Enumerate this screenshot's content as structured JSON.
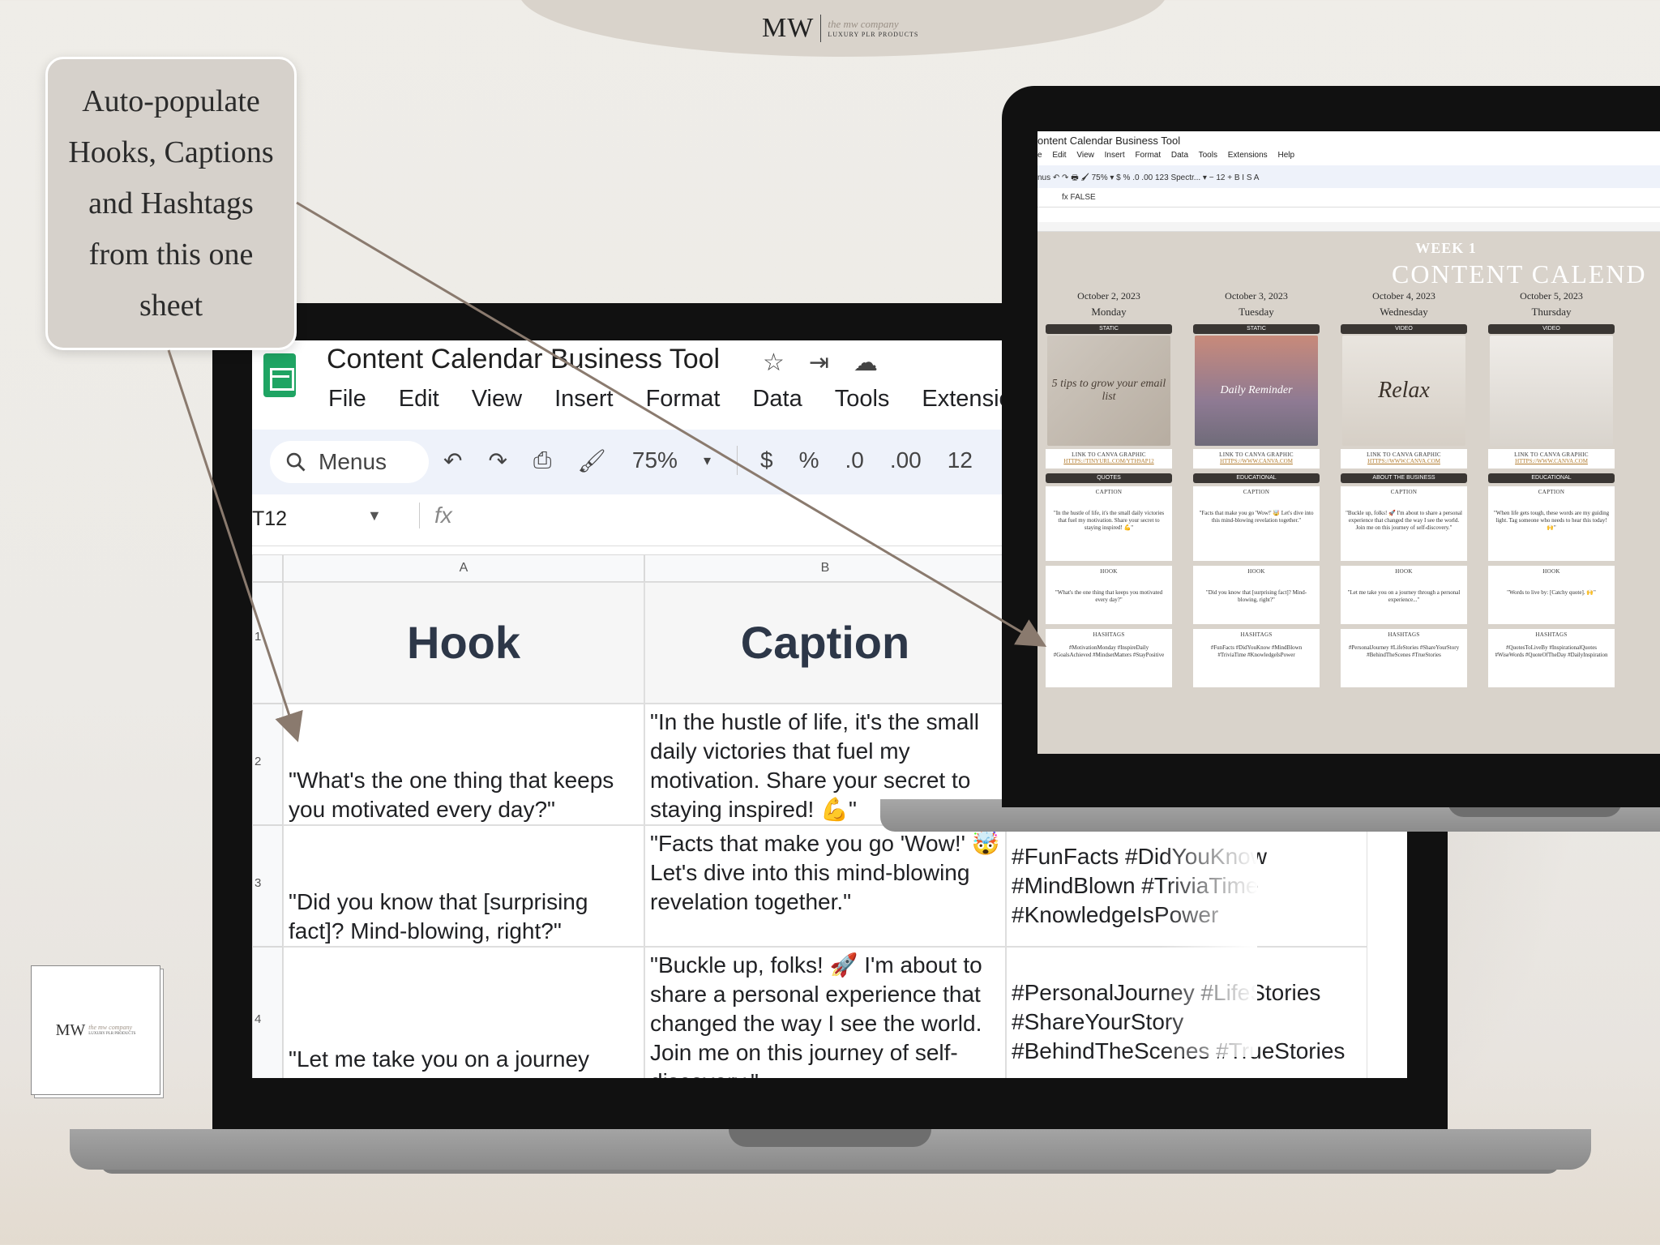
{
  "brand": {
    "initials": "MW",
    "tagline": "the mw company",
    "line": "LUXURY PLR PRODUCTS"
  },
  "callout": {
    "text": "Auto-populate Hooks, Captions and Hashtags from this one sheet"
  },
  "sheet": {
    "title": "Content Calendar Business Tool",
    "menu": [
      "File",
      "Edit",
      "View",
      "Insert",
      "Format",
      "Data",
      "Tools",
      "Extensions"
    ],
    "search_label": "Menus",
    "zoom": "75%",
    "currency": "$",
    "percent": "%",
    "dec_less": ".0",
    "dec_more": ".00",
    "fmt_more": "12",
    "cell_ref": "T12",
    "columns": [
      "A",
      "B"
    ],
    "row_numbers": [
      "1",
      "2",
      "3",
      "4"
    ],
    "headers": {
      "hook": "Hook",
      "caption": "Caption"
    },
    "rows": [
      {
        "hook": "\"What's the one thing that keeps you motivated every day?\"",
        "caption": "\"In the hustle of life, it's the small daily victories that fuel my motivation. Share your secret to staying inspired! 💪\"",
        "hashtags": ""
      },
      {
        "hook": "\"Did you know that [surprising fact]? Mind-blowing, right?\"",
        "caption": "\"Facts that make you go 'Wow!' 🤯 Let's dive into this mind-blowing revelation together.\"",
        "hashtags": "#FunFacts #DidYouKnow #MindBlown #TriviaTime #KnowledgeIsPower"
      },
      {
        "hook": "\"Let me take you on a journey through a personal experience...\"",
        "caption": "\"Buckle up, folks! 🚀 I'm about to share a personal experience that changed the way I see the world. Join me on this journey of self-discovery.\"",
        "hashtags": "#PersonalJourney #LifeStories #ShareYourStory #BehindTheScenes #TrueStories"
      }
    ]
  },
  "calendar": {
    "title": "ontent Calendar Business Tool",
    "menu": [
      "e",
      "Edit",
      "View",
      "Insert",
      "Format",
      "Data",
      "Tools",
      "Extensions",
      "Help"
    ],
    "toolbar": "nus   ↶  ↷  🖶  🖌  75%  ▾   $   %   .0   .00   123   Spectr... ▾   −  12  +   B   I   S   A",
    "formula": "fx  FALSE",
    "week": "WEEK 1",
    "heading": "CONTENT CALEND",
    "link_label": "LINK TO CANVA GRAPHIC",
    "caption_label": "CAPTION",
    "hook_label": "HOOK",
    "hashtags_label": "HASHTAGS",
    "days": [
      {
        "date": "October 2, 2023",
        "name": "Monday",
        "type": "STATIC",
        "graphic": "5 tips to grow your email list",
        "link": "HTTPS://TINYURL.COM/YTH9AP12",
        "category": "QUOTES",
        "caption": "\"In the hustle of life, it's the small daily victories that fuel my motivation. Share your secret to staying inspired! 💪\"",
        "hook": "\"What's the one thing that keeps you motivated every day?\"",
        "hashtags": "#MotivationMonday #InspireDaily #GoalsAchieved #MindsetMatters #StayPositive"
      },
      {
        "date": "October 3, 2023",
        "name": "Tuesday",
        "type": "STATIC",
        "graphic": "Daily Reminder",
        "link": "HTTPS://WWW.CANVA.COM",
        "category": "EDUCATIONAL",
        "caption": "\"Facts that make you go 'Wow!' 🤯 Let's dive into this mind-blowing revelation together.\"",
        "hook": "\"Did you know that [surprising fact]? Mind-blowing, right?\"",
        "hashtags": "#FunFacts #DidYouKnow #MindBlown #TriviaTime #KnowledgeIsPower"
      },
      {
        "date": "October 4, 2023",
        "name": "Wednesday",
        "type": "VIDEO",
        "graphic": "Relax",
        "link": "HTTPS://WWW.CANVA.COM",
        "category": "ABOUT THE BUSINESS",
        "caption": "\"Buckle up, folks! 🚀 I'm about to share a personal experience that changed the way I see the world. Join me on this journey of self-discovery.\"",
        "hook": "\"Let me take you on a journey through a personal experience...\"",
        "hashtags": "#PersonalJourney #LifeStories #ShareYourStory #BehindTheScenes #TrueStories"
      },
      {
        "date": "October 5, 2023",
        "name": "Thursday",
        "type": "VIDEO",
        "graphic": "",
        "link": "HTTPS://WWW.CANVA.COM",
        "category": "EDUCATIONAL",
        "caption": "\"When life gets tough, these words are my guiding light. Tag someone who needs to hear this today! 🙌\"",
        "hook": "\"Words to live by: [Catchy quote]. 🙌\"",
        "hashtags": "#QuotesToLiveBy #InspirationalQuotes #WiseWords #QuoteOfTheDay #DailyInspiration"
      }
    ]
  }
}
